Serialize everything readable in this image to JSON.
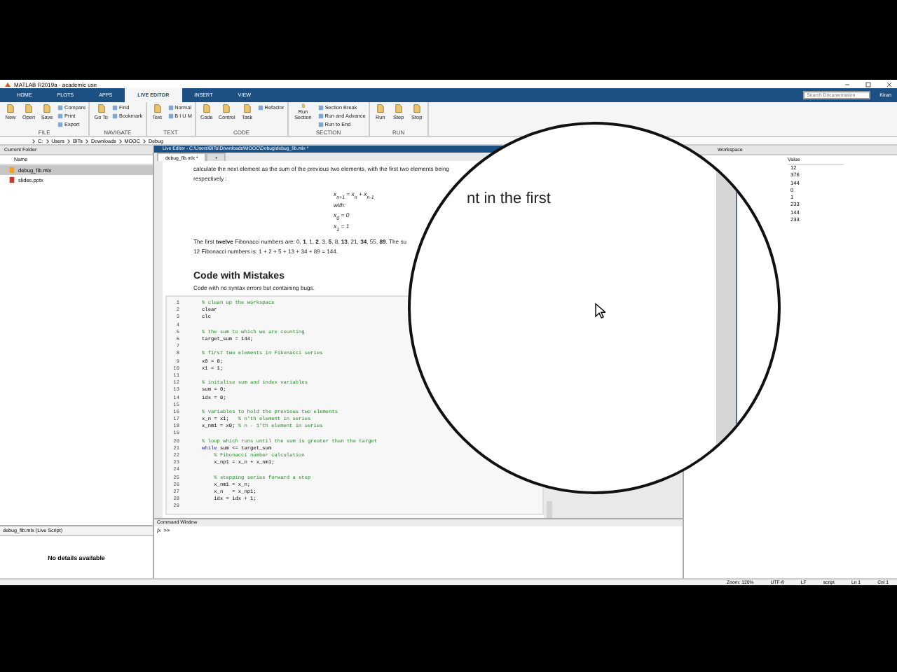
{
  "window": {
    "title": "MATLAB R2019a - academic use"
  },
  "ribbon_tabs": [
    {
      "label": "HOME",
      "selected": false
    },
    {
      "label": "PLOTS",
      "selected": false
    },
    {
      "label": "APPS",
      "selected": false
    },
    {
      "label": "LIVE EDITOR",
      "selected": true
    },
    {
      "label": "INSERT",
      "selected": false
    },
    {
      "label": "VIEW",
      "selected": false
    }
  ],
  "search": {
    "placeholder": "Search Documentation"
  },
  "user_menu": "Kiran",
  "toolstrip": [
    {
      "group": "FILE",
      "tools": [
        {
          "label": "New",
          "kind": "large"
        },
        {
          "label": "Open",
          "kind": "large"
        },
        {
          "label": "Save",
          "kind": "large"
        },
        {
          "label": "Compare",
          "kind": "small"
        },
        {
          "label": "Print",
          "kind": "small"
        },
        {
          "label": "Export",
          "kind": "small"
        }
      ]
    },
    {
      "group": "NAVIGATE",
      "tools": [
        {
          "label": "Go To",
          "kind": "large"
        },
        {
          "label": "Find",
          "kind": "small"
        },
        {
          "label": "Bookmark",
          "kind": "small"
        }
      ]
    },
    {
      "group": "TEXT",
      "tools": [
        {
          "label": "Text",
          "kind": "large"
        },
        {
          "label": "Normal",
          "kind": "small"
        },
        {
          "label": "B  I  U  M",
          "kind": "small"
        }
      ]
    },
    {
      "group": "CODE",
      "tools": [
        {
          "label": "Code",
          "kind": "large"
        },
        {
          "label": "Control",
          "kind": "large"
        },
        {
          "label": "Task",
          "kind": "large"
        },
        {
          "label": "Refactor",
          "kind": "small"
        }
      ]
    },
    {
      "group": "SECTION",
      "tools": [
        {
          "label": "Run Section",
          "kind": "large"
        },
        {
          "label": "Section Break",
          "kind": "small"
        },
        {
          "label": "Run and Advance",
          "kind": "small"
        },
        {
          "label": "Run to End",
          "kind": "small"
        }
      ]
    },
    {
      "group": "RUN",
      "tools": [
        {
          "label": "Run",
          "kind": "large"
        },
        {
          "label": "Step",
          "kind": "large"
        },
        {
          "label": "Stop",
          "kind": "large"
        }
      ]
    }
  ],
  "address_bar": {
    "path": [
      "C:",
      "Users",
      "BITs",
      "Downloads",
      "MOOC",
      "Debug"
    ]
  },
  "current_folder": {
    "title": "Current Folder",
    "column": "Name",
    "files": [
      {
        "name": "debug_fib.mlx",
        "selected": true,
        "kind": "live-script"
      },
      {
        "name": "slides.pptx",
        "selected": false,
        "kind": "presentation"
      }
    ],
    "details_title": "debug_fib.mlx  (Live Script)",
    "details_message": "No details available"
  },
  "editor": {
    "title": "Live Editor - C:\\Users\\BITs\\Downloads\\MOOC\\Debug\\debug_fib.mlx *",
    "tabs": [
      {
        "label": "debug_fib.mlx *",
        "selected": true
      }
    ],
    "new_tab": "+",
    "intro_lines": [
      "calculate the next element as the sum of the previous two elements, with the first two elements being",
      "respectively :"
    ],
    "equations": [
      "x$_{n+1}$ = x$_{n}$ + x$_{n-1}$",
      "with:",
      "x$_{0}$ = 0",
      "x$_{1}$ = 1"
    ],
    "fact_lines": [
      "The first **twelve** Fibonacci numbers are: 0, **1**, 1, **2**, 3, **5**, 8, **13**, 21, **34**, 55, **89**. The su",
      "12 Fibonacci numbers is: 1 + 2 + 5 + 13 + 34 + 89 = 144."
    ],
    "heading": "Code with Mistakes",
    "subtitle": "Code with no syntax errors but containing bugs.",
    "code_lines": [
      {
        "number": "1",
        "segments": [
          {
            "text": "% clean up the workspace",
            "kind": "comment"
          }
        ]
      },
      {
        "number": "2",
        "segments": [
          {
            "text": "clear",
            "kind": "code"
          }
        ]
      },
      {
        "number": "3",
        "segments": [
          {
            "text": "clc",
            "kind": "code"
          }
        ]
      },
      {
        "number": "4"
      },
      {
        "number": "5",
        "segments": [
          {
            "text": "% the sum to which we are counting",
            "kind": "comment"
          }
        ]
      },
      {
        "number": "6",
        "segments": [
          {
            "text": "target_sum = 144;",
            "kind": "code"
          }
        ]
      },
      {
        "number": "7"
      },
      {
        "number": "8",
        "segments": [
          {
            "text": "% first two elements in Fibonacci series",
            "kind": "comment"
          }
        ]
      },
      {
        "number": "9",
        "segments": [
          {
            "text": "x0 = 0;",
            "kind": "code"
          }
        ]
      },
      {
        "number": "10",
        "segments": [
          {
            "text": "x1 = 1;",
            "kind": "code"
          }
        ]
      },
      {
        "number": "11"
      },
      {
        "number": "12",
        "segments": [
          {
            "text": "% initalise sum and index variables",
            "kind": "comment"
          }
        ]
      },
      {
        "number": "13",
        "segments": [
          {
            "text": "sum = 0;",
            "kind": "code"
          }
        ]
      },
      {
        "number": "14",
        "segments": [
          {
            "text": "idx = 0;",
            "kind": "code"
          }
        ]
      },
      {
        "number": "15"
      },
      {
        "number": "16",
        "segments": [
          {
            "text": "% variables to hold the previous two elements",
            "kind": "comment"
          }
        ]
      },
      {
        "number": "17",
        "segments": [
          {
            "text": "x_n = x1;   ",
            "kind": "code"
          },
          {
            "text": "% n'th element in series",
            "kind": "comment"
          }
        ]
      },
      {
        "number": "18",
        "segments": [
          {
            "text": "x_nm1 = x0; ",
            "kind": "code"
          },
          {
            "text": "% n - 1'th element in series",
            "kind": "comment"
          }
        ]
      },
      {
        "number": "19"
      },
      {
        "number": "20",
        "segments": [
          {
            "text": "% loop which runs until the sum is greater than the target",
            "kind": "comment"
          }
        ]
      },
      {
        "number": "21",
        "segments": [
          {
            "text": "while",
            "kind": "keyword"
          },
          {
            "text": " sum <= target_sum",
            "kind": "code"
          }
        ]
      },
      {
        "number": "22",
        "segments": [
          {
            "text": "    % Fibonacci number calculation",
            "kind": "comment"
          }
        ]
      },
      {
        "number": "23",
        "segments": [
          {
            "text": "    x_np1 = x_n + x_nm1;",
            "kind": "code"
          }
        ]
      },
      {
        "number": "24"
      },
      {
        "number": "25",
        "segments": [
          {
            "text": "    % stepping series forward a step",
            "kind": "comment"
          }
        ]
      },
      {
        "number": "26",
        "segments": [
          {
            "text": "    x_nm1 = x_n;",
            "kind": "code"
          }
        ]
      },
      {
        "number": "27",
        "segments": [
          {
            "text": "    x_n   = x_np1;",
            "kind": "code"
          }
        ]
      },
      {
        "number": "28",
        "segments": [
          {
            "text": "    idx = idx + 1;",
            "kind": "code"
          }
        ]
      },
      {
        "number": "29"
      }
    ]
  },
  "magnifier": {
    "text": "nt in the first"
  },
  "command_window": {
    "title": "Command Window",
    "fx_label": "fx",
    "prompt": ">>"
  },
  "workspace": {
    "title": "Workspace",
    "column": "Value",
    "values": [
      "12",
      "376",
      "144",
      "0",
      "1",
      "233",
      "144",
      "233"
    ]
  },
  "status_bar": [
    "Zoom: 120%",
    "UTF-8",
    "LF",
    "script",
    "Ln 1",
    "Col 1"
  ]
}
